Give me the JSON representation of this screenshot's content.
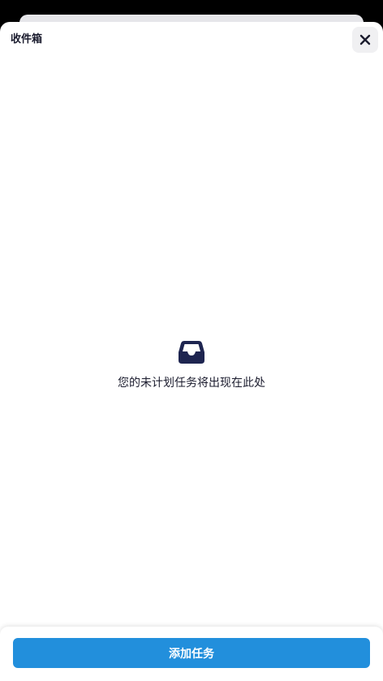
{
  "sheet": {
    "title": "收件箱",
    "close_icon": "close-icon"
  },
  "empty_state": {
    "icon": "inbox-icon",
    "message": "您的未计划任务将出现在此处"
  },
  "footer": {
    "add_task_label": "添加任务"
  },
  "colors": {
    "accent": "#228fdc",
    "text": "#1b1c2e",
    "icon": "#1e2550"
  }
}
